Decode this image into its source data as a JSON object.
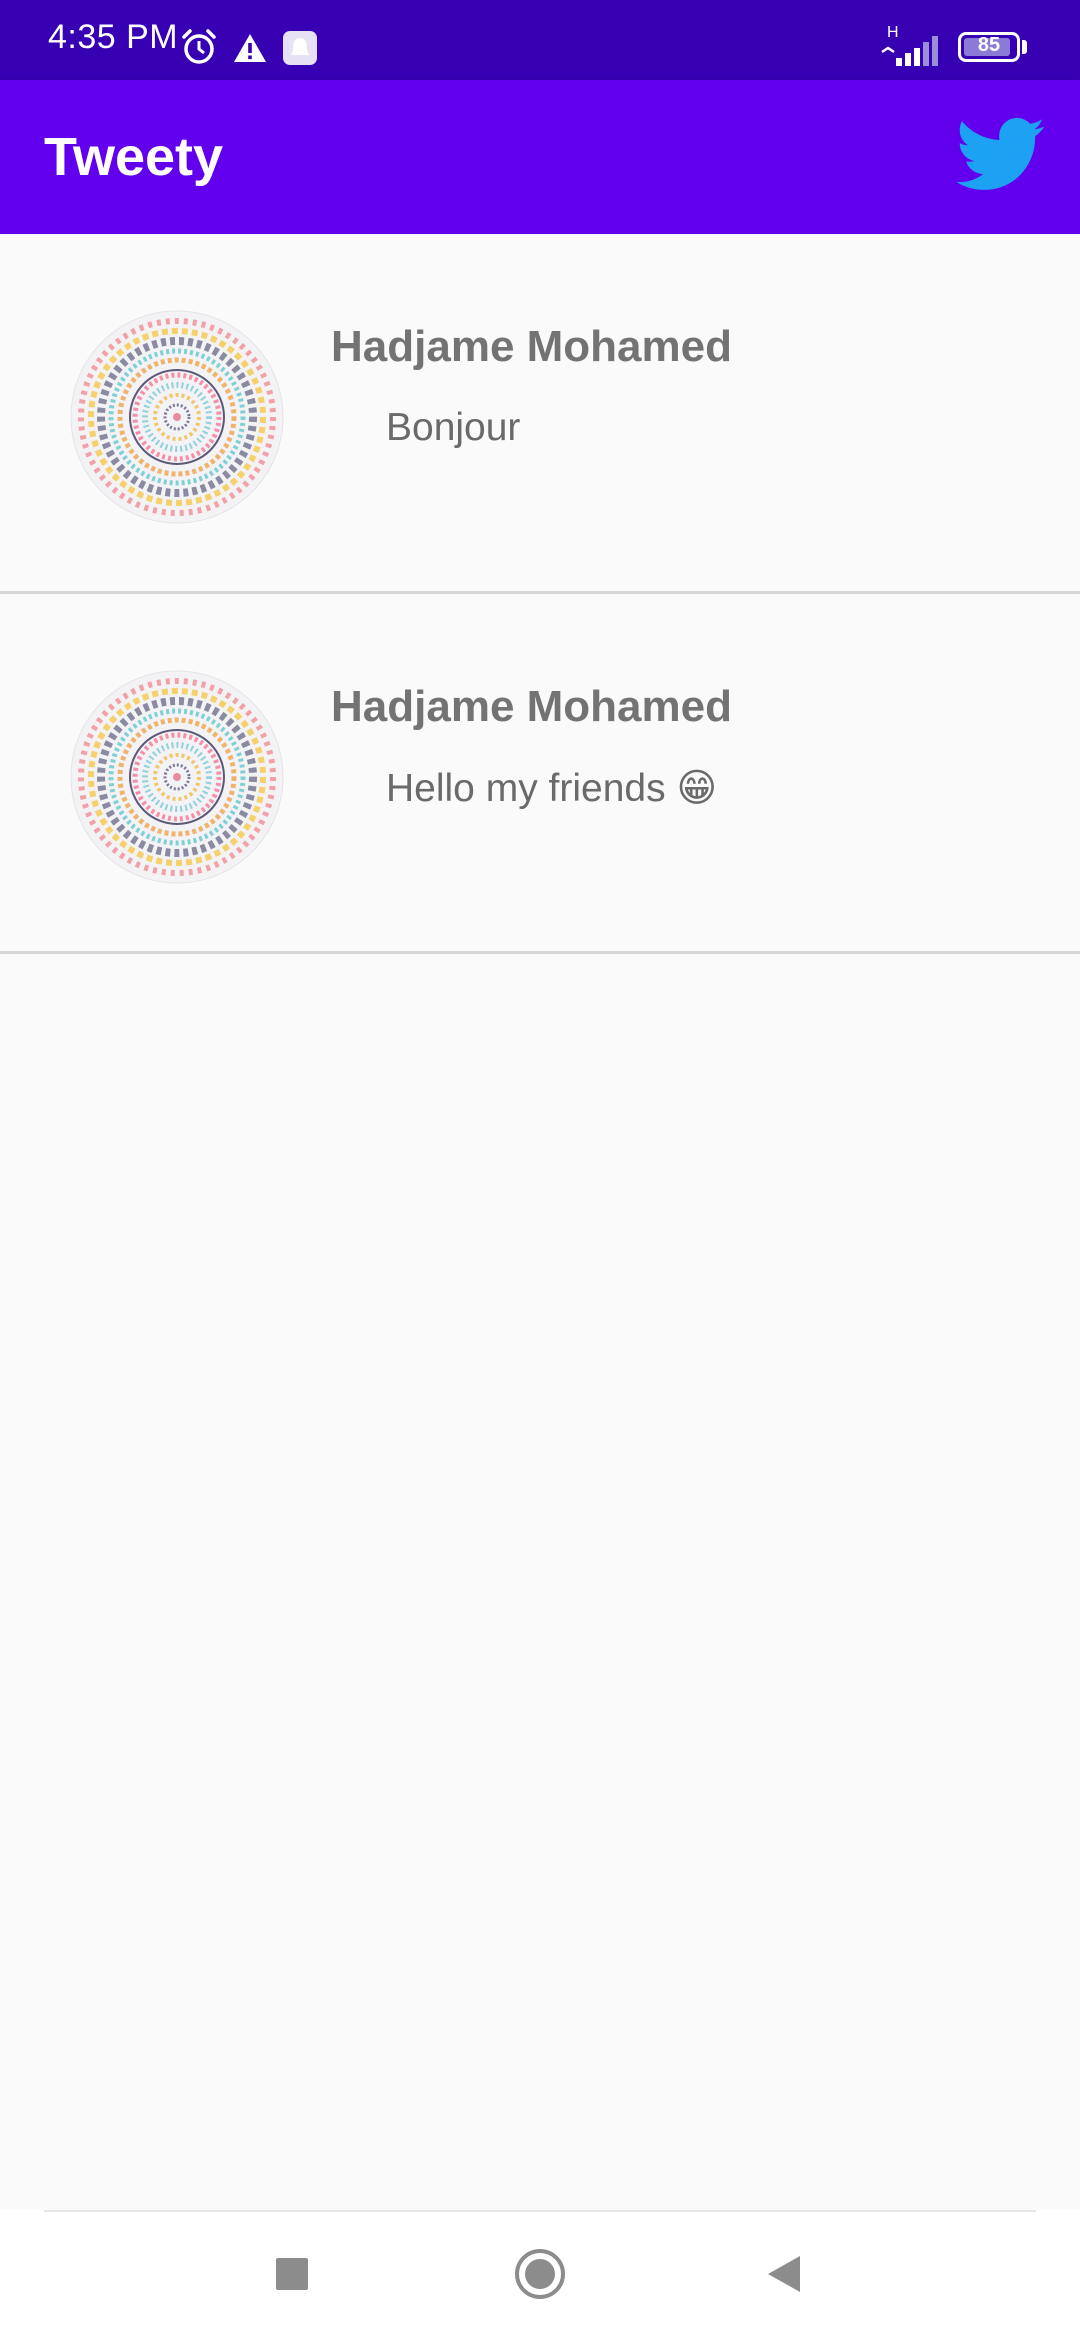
{
  "status_bar": {
    "time": "4:35 PM",
    "network_type": "H",
    "battery_level": "85",
    "icons": [
      "alarm-icon",
      "warning-icon",
      "notification-bell-icon",
      "signal-icon",
      "battery-icon"
    ]
  },
  "app_bar": {
    "title": "Tweety",
    "logo_icon": "twitter-bird-icon",
    "color": "#6200ee"
  },
  "tweets": [
    {
      "author": "Hadjame Mohamed",
      "text": "Bonjour"
    },
    {
      "author": "Hadjame Mohamed",
      "text": "Hello my friends 😁"
    }
  ],
  "nav_bar": {
    "buttons": [
      "recent-apps-icon",
      "home-icon",
      "back-icon"
    ]
  },
  "colors": {
    "status_bar": "#3700b3",
    "app_bar": "#6200ee",
    "twitter_blue": "#1da1f2",
    "background": "#fafafa"
  }
}
